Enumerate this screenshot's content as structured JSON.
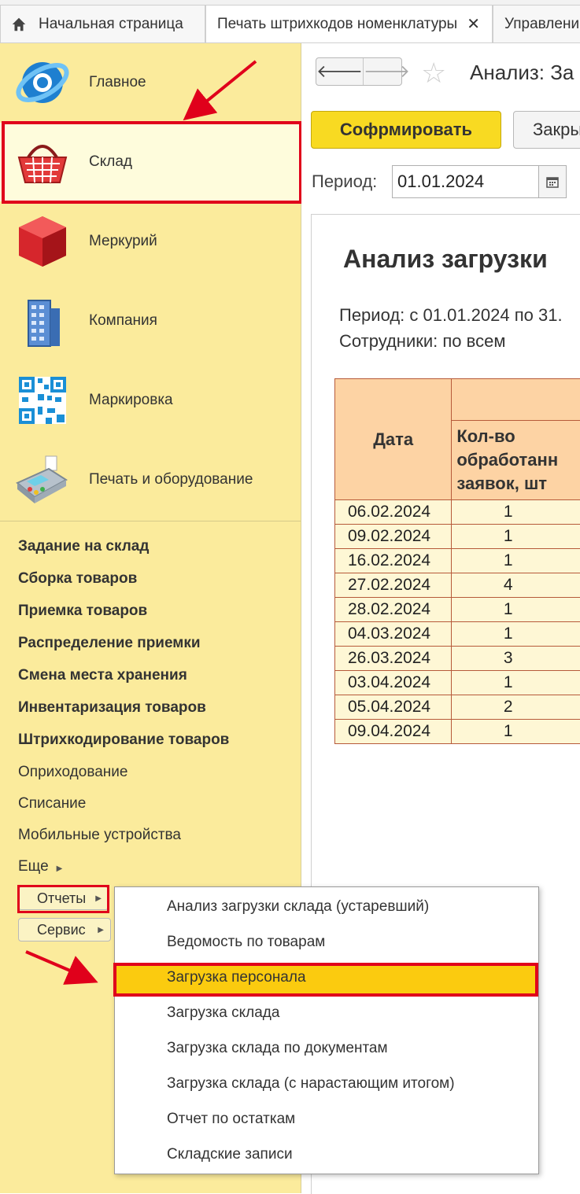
{
  "tabs": [
    {
      "label": "Начальная страница",
      "icon": "home-icon"
    },
    {
      "label": "Печать штрихкодов номенклатуры",
      "close": "✕"
    },
    {
      "label": "Управлени"
    }
  ],
  "sidebar": {
    "sections": [
      {
        "label": "Главное",
        "icon": "globe-logo-icon"
      },
      {
        "label": "Склад",
        "icon": "basket-icon",
        "selected": true
      },
      {
        "label": "Меркурий",
        "icon": "red-cube-icon"
      },
      {
        "label": "Компания",
        "icon": "building-icon"
      },
      {
        "label": "Маркировка",
        "icon": "qr-code-icon"
      },
      {
        "label": "Печать и оборудование",
        "icon": "payment-terminal-icon"
      }
    ],
    "commands_bold": [
      "Задание на склад",
      "Сборка товаров",
      "Приемка товаров",
      "Распределение приемки",
      "Смена места хранения",
      "Инвентаризация товаров",
      "Штрихкодирование товаров"
    ],
    "commands": [
      "Оприходование",
      "Списание",
      "Мобильные устройства"
    ],
    "more": "Еще",
    "reports_button": "Отчеты",
    "service_button": "Сервис"
  },
  "main": {
    "title": "Анализ: За",
    "generate_button": "Софрмировать",
    "close_button": "Закры",
    "period_label": "Период:",
    "period_value": "01.01.2024"
  },
  "report": {
    "title": "Анализ загрузки",
    "period_line": "Период: с 01.01.2024 по 31.",
    "employees_line": "Сотрудники: по всем",
    "col_date": "Дата",
    "col_count": "Кол-во обработанн заявок, шт",
    "rows": [
      {
        "date": "06.02.2024",
        "count": "1"
      },
      {
        "date": "09.02.2024",
        "count": "1"
      },
      {
        "date": "16.02.2024",
        "count": "1"
      },
      {
        "date": "27.02.2024",
        "count": "4"
      },
      {
        "date": "28.02.2024",
        "count": "1"
      },
      {
        "date": "04.03.2024",
        "count": "1"
      },
      {
        "date": "26.03.2024",
        "count": "3"
      },
      {
        "date": "03.04.2024",
        "count": "1"
      },
      {
        "date": "05.04.2024",
        "count": "2"
      },
      {
        "date": "09.04.2024",
        "count": "1"
      }
    ]
  },
  "reports_menu": {
    "items": [
      "Анализ загрузки склада (устаревший)",
      "Ведомость по товарам",
      "Загрузка персонала",
      "Загрузка склада",
      "Загрузка склада по документам",
      "Загрузка склада (с нарастающим итогом)",
      "Отчет по остаткам",
      "Складские записи"
    ],
    "highlighted_index": 2
  },
  "colors": {
    "sidebar_bg": "#fbeb9c",
    "accent_yellow": "#f8da22",
    "annotation_red": "#e0001b",
    "table_header": "#fdd3a4",
    "table_cell": "#fef7d5"
  }
}
